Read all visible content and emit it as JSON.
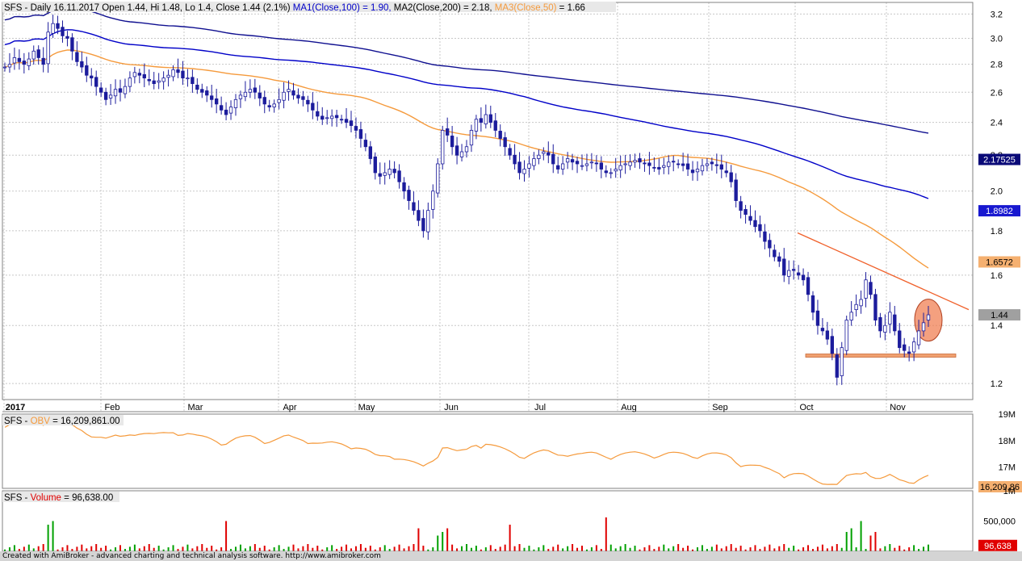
{
  "app": {
    "footer": "Created with AmiBroker - advanced charting and technical analysis software. http://www.amibroker.com"
  },
  "price_header": {
    "prefix": "SFS - Daily 16.11.2017 Open 1.44, Hi 1.48, Lo 1.4, Close 1.44 (2.1%)",
    "ma1": "MA1(Close,100) = 1.90,",
    "ma2": "MA2(Close,200) = 2.18,",
    "ma3_name": "MA3(Close,50)",
    "ma3_val": "= 1.66"
  },
  "obv_header": {
    "prefix": "SFS -",
    "name": "OBV",
    "val": "= 16,209,861.00"
  },
  "vol_header": {
    "prefix": "SFS -",
    "name": "Volume",
    "val": "= 96,638.00"
  },
  "colors": {
    "up_candle": "#ffffff",
    "down_candle": "#1c1c9c",
    "ma1": "#0000c8",
    "ma2": "#101090",
    "ma3": "#f59a3c",
    "obv": "#f59a3c",
    "vol_up": "#00a000",
    "vol_down": "#e00000",
    "trendline": "#f0602a",
    "support": "#f0a070",
    "highlight": "#f07848"
  },
  "chart_data": [
    {
      "type": "candlestick",
      "title": "SFS - Daily",
      "x_months": [
        "2017",
        "Feb",
        "Mar",
        "Apr",
        "May",
        "Jun",
        "Jul",
        "Aug",
        "Sep",
        "Oct",
        "Nov"
      ],
      "ylim": [
        1.15,
        3.3
      ],
      "y_scale": "log",
      "y_ticks": [
        "3.2",
        "3.0",
        "2.8",
        "2.6",
        "2.4",
        "2.2",
        "2.0",
        "1.8",
        "1.6",
        "1.4",
        "1.2"
      ],
      "value_labels": [
        "2.17525",
        "1.8982",
        "1.6572",
        "1.44"
      ],
      "last_bar": {
        "date": "16.11.2017",
        "open": 1.44,
        "high": 1.48,
        "low": 1.4,
        "close": 1.44,
        "change_pct": 2.1
      },
      "closes": [
        2.78,
        2.8,
        2.85,
        2.82,
        2.8,
        2.84,
        2.9,
        2.85,
        2.8,
        3.05,
        3.12,
        3.08,
        3.02,
        3.0,
        2.9,
        2.82,
        2.78,
        2.72,
        2.7,
        2.64,
        2.6,
        2.55,
        2.58,
        2.62,
        2.6,
        2.64,
        2.7,
        2.74,
        2.72,
        2.7,
        2.68,
        2.66,
        2.68,
        2.7,
        2.72,
        2.76,
        2.74,
        2.7,
        2.7,
        2.66,
        2.62,
        2.6,
        2.58,
        2.55,
        2.52,
        2.48,
        2.45,
        2.5,
        2.55,
        2.58,
        2.6,
        2.62,
        2.6,
        2.56,
        2.52,
        2.5,
        2.52,
        2.55,
        2.6,
        2.62,
        2.58,
        2.56,
        2.55,
        2.52,
        2.48,
        2.44,
        2.42,
        2.43,
        2.44,
        2.43,
        2.42,
        2.4,
        2.38,
        2.35,
        2.3,
        2.25,
        2.18,
        2.1,
        2.08,
        2.1,
        2.12,
        2.1,
        2.05,
        2.0,
        1.95,
        1.9,
        1.85,
        1.8,
        1.9,
        2.0,
        2.15,
        2.35,
        2.32,
        2.25,
        2.2,
        2.22,
        2.25,
        2.35,
        2.42,
        2.4,
        2.45,
        2.4,
        2.35,
        2.3,
        2.25,
        2.2,
        2.15,
        2.1,
        2.12,
        2.15,
        2.18,
        2.2,
        2.22,
        2.2,
        2.15,
        2.12,
        2.15,
        2.18,
        2.16,
        2.15,
        2.14,
        2.15,
        2.16,
        2.15,
        2.12,
        2.1,
        2.1,
        2.12,
        2.14,
        2.15,
        2.16,
        2.17,
        2.16,
        2.15,
        2.14,
        2.13,
        2.12,
        2.14,
        2.16,
        2.16,
        2.15,
        2.14,
        2.12,
        2.1,
        2.12,
        2.14,
        2.15,
        2.15,
        2.14,
        2.12,
        2.1,
        2.05,
        1.95,
        1.9,
        1.88,
        1.85,
        1.82,
        1.8,
        1.75,
        1.72,
        1.68,
        1.66,
        1.6,
        1.62,
        1.62,
        1.6,
        1.58,
        1.52,
        1.45,
        1.4,
        1.38,
        1.35,
        1.3,
        1.22,
        1.32,
        1.42,
        1.45,
        1.48,
        1.5,
        1.58,
        1.52,
        1.42,
        1.38,
        1.4,
        1.45,
        1.38,
        1.32,
        1.31,
        1.3,
        1.34,
        1.38,
        1.41,
        1.44
      ],
      "ma1_label": "1.8982",
      "ma2_label": "2.17525",
      "ma3_label": "1.6572"
    },
    {
      "type": "line",
      "title": "OBV",
      "ylim": [
        16200000,
        19000000
      ],
      "y_ticks": [
        "19M",
        "18M",
        "17M"
      ],
      "value_label": "16,209,86"
    },
    {
      "type": "bar",
      "title": "Volume",
      "ylim": [
        0,
        1000000
      ],
      "y_ticks": [
        "1M",
        "500,000"
      ],
      "value_label": "96,638"
    }
  ]
}
